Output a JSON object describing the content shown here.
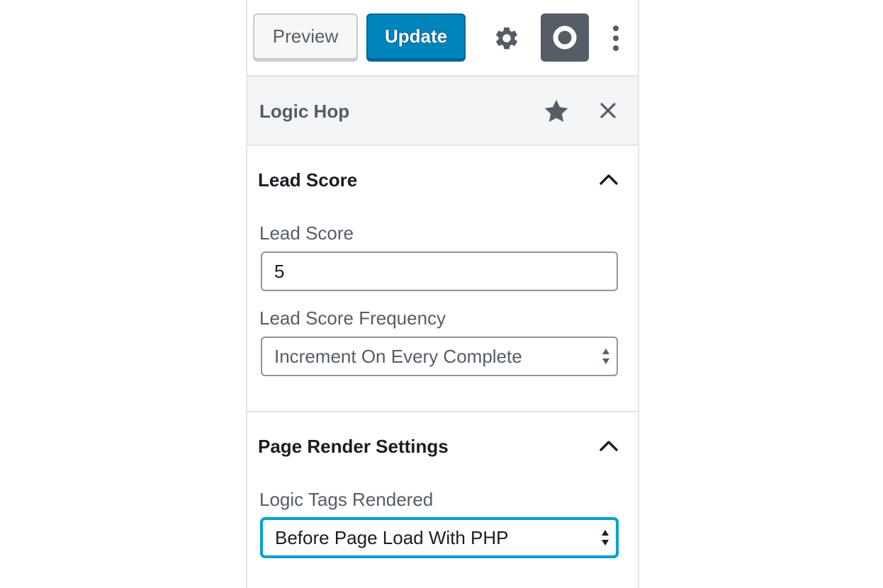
{
  "toolbar": {
    "preview_label": "Preview",
    "update_label": "Update",
    "settings_icon": "gear-icon",
    "plugin_icon": "logic-hop-circle-icon",
    "more_icon": "more-vertical-icon",
    "accent_color": "#0085ba"
  },
  "sidebar": {
    "title": "Logic Hop",
    "star_icon": "star-icon",
    "close_icon": "close-icon"
  },
  "sections": [
    {
      "title": "Lead Score",
      "expanded": true,
      "fields": [
        {
          "label": "Lead Score",
          "type": "number",
          "value": "5"
        },
        {
          "label": "Lead Score Frequency",
          "type": "select",
          "value": "Increment On Every Complete"
        }
      ]
    },
    {
      "title": "Page Render Settings",
      "expanded": true,
      "fields": [
        {
          "label": "Logic Tags Rendered",
          "type": "select",
          "value": "Before Page Load With PHP",
          "focused": true,
          "focus_color": "#00a0d2"
        }
      ]
    }
  ]
}
